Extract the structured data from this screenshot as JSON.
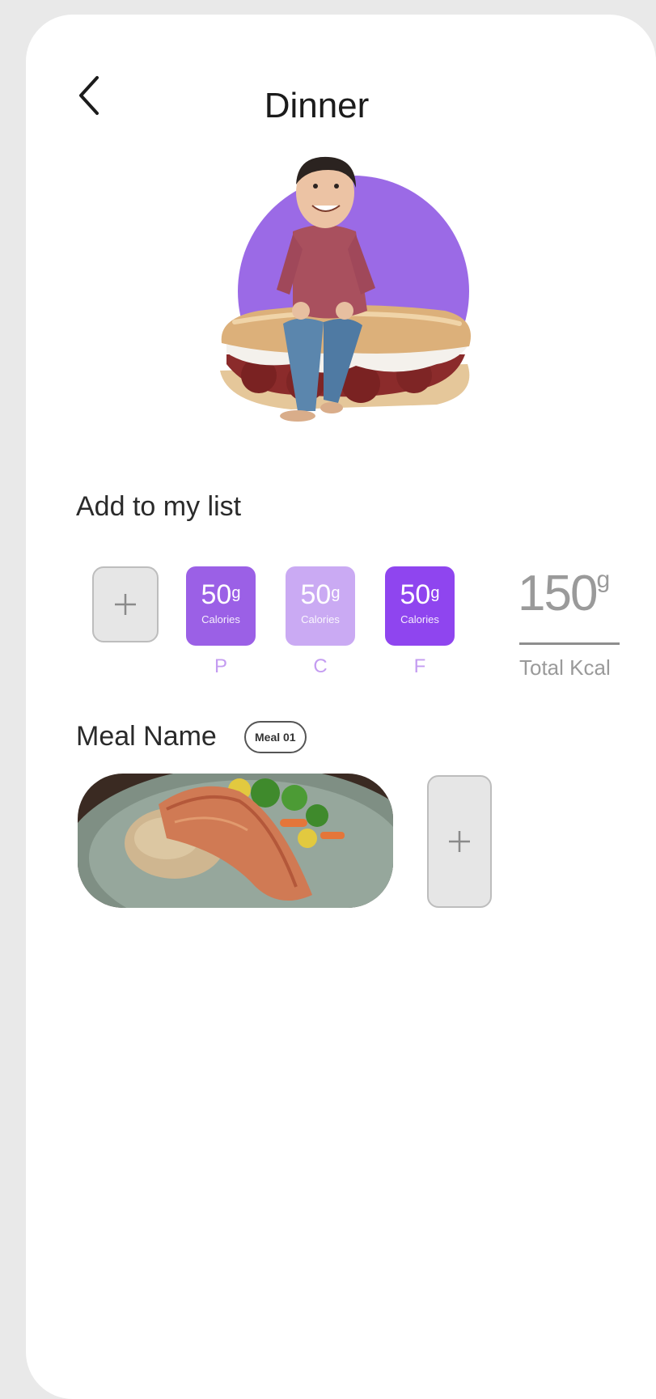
{
  "header": {
    "title": "Dinner",
    "back_icon": "chevron-left-icon"
  },
  "colors": {
    "hero_circle": "#9b6ae6",
    "protein": "#9b60e6",
    "carbs": "#caaaf3",
    "fat": "#8f45ef",
    "letter": "#c49cf1",
    "total": "#9a9a9a"
  },
  "add_list": {
    "label": "Add to my list",
    "add_icon": "plus-icon",
    "macros": [
      {
        "amount": "50",
        "unit": "g",
        "label": "Calories",
        "letter": "P"
      },
      {
        "amount": "50",
        "unit": "g",
        "label": "Calories",
        "letter": "C"
      },
      {
        "amount": "50",
        "unit": "g",
        "label": "Calories",
        "letter": "F"
      }
    ],
    "total": {
      "value": "150",
      "unit": "g",
      "label": "Total Kcal"
    }
  },
  "meal": {
    "label": "Meal Name",
    "badge": "Meal 01",
    "add_icon": "plus-icon"
  }
}
